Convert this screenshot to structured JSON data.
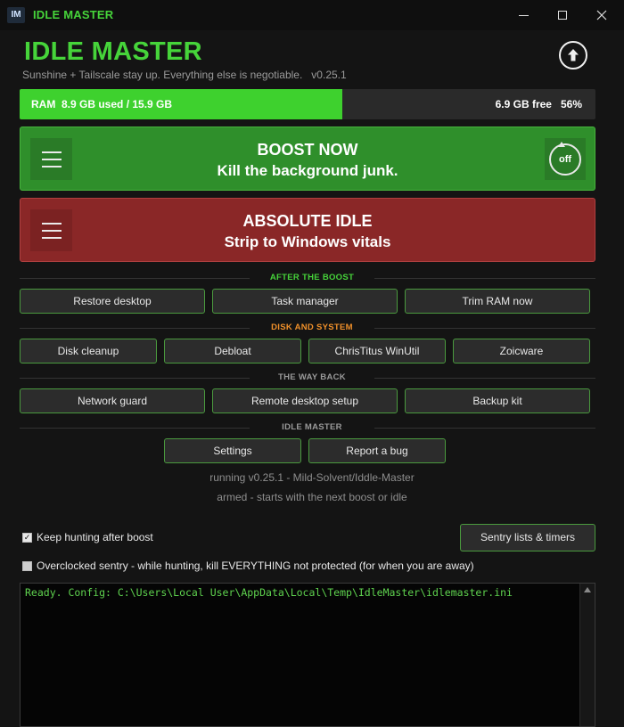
{
  "window": {
    "icon_text": "IM",
    "title": "IDLE MASTER",
    "controls": [
      "minimize-icon",
      "maximize-icon",
      "close-icon"
    ]
  },
  "header": {
    "title": "IDLE MASTER",
    "subtitle": "Sunshine + Tailscale stay up. Everything else is negotiable.   v0.25.1",
    "update_icon": "arrow-up-circle-icon"
  },
  "ram": {
    "label": "RAM  8.9 GB used / 15.9 GB",
    "free": "6.9 GB free",
    "percent": "56%",
    "used_fraction": 0.56
  },
  "boost": {
    "title": "BOOST NOW",
    "subtitle": "Kill the background junk.",
    "toggle": "off",
    "color": "#2f8f2b"
  },
  "absolute_idle": {
    "title": "ABSOLUTE IDLE",
    "subtitle": "Strip to Windows vitals",
    "color": "#8a2727"
  },
  "sections": {
    "after_boost": {
      "title": "AFTER THE BOOST",
      "buttons": [
        "Restore desktop",
        "Task manager",
        "Trim RAM now"
      ]
    },
    "disk_system": {
      "title": "DISK AND SYSTEM",
      "buttons": [
        "Disk cleanup",
        "Debloat",
        "ChrisTitus WinUtil",
        "Zoicware"
      ]
    },
    "way_back": {
      "title": "THE WAY BACK",
      "buttons": [
        "Network guard",
        "Remote desktop setup",
        "Backup kit"
      ]
    },
    "idle_master": {
      "title": "IDLE MASTER",
      "buttons": [
        "Settings",
        "Report a bug"
      ]
    }
  },
  "status": {
    "running": "running v0.25.1 - Mild-Solvent/Iddle-Master",
    "armed": "armed - starts with the next boost or idle"
  },
  "options": {
    "keep_hunting": {
      "label": "Keep hunting after boost",
      "checked": true
    },
    "overclocked_sentry": {
      "label": "Overclocked sentry - while hunting, kill EVERYTHING not protected (for when you are away)",
      "checked": false
    },
    "sentry_button": "Sentry lists & timers"
  },
  "log": {
    "text": "Ready. Config: C:\\Users\\Local User\\AppData\\Local\\Temp\\IdleMaster\\idlemaster.ini"
  },
  "colors": {
    "accent_green": "#46d43a",
    "disk_orange": "#f0902a",
    "log_green": "#5fd34f"
  }
}
